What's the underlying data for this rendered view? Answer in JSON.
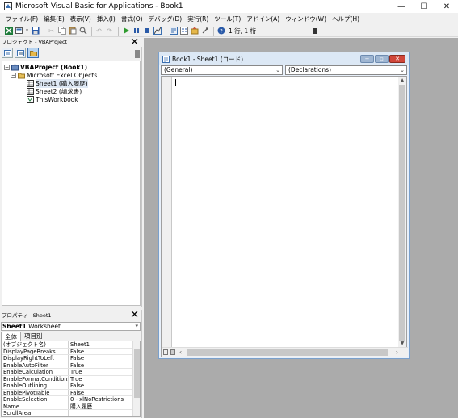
{
  "window": {
    "title": "Microsoft Visual Basic for Applications - Book1",
    "minimize": "—",
    "maximize": "☐",
    "close": "✕"
  },
  "menu": [
    "ファイル(F)",
    "編集(E)",
    "表示(V)",
    "挿入(I)",
    "書式(O)",
    "デバッグ(D)",
    "実行(R)",
    "ツール(T)",
    "アドイン(A)",
    "ウィンドウ(W)",
    "ヘルプ(H)"
  ],
  "toolbar": {
    "position": "1 行, 1 桁"
  },
  "project_pane": {
    "title": "プロジェクト - VBAProject",
    "tree": [
      {
        "label": "VBAProject (Book1)",
        "bold": true
      },
      {
        "label": "Microsoft Excel Objects"
      },
      {
        "label": "Sheet1 (購入履歴)"
      },
      {
        "label": "Sheet2 (請求書)"
      },
      {
        "label": "ThisWorkbook"
      }
    ]
  },
  "properties_pane": {
    "title": "プロパティ - Sheet1",
    "object_name": "Sheet1",
    "object_type": "Worksheet",
    "tabs": [
      "全体",
      "項目別"
    ],
    "rows": [
      {
        "name": "(オブジェクト名)",
        "value": "Sheet1"
      },
      {
        "name": "DisplayPageBreaks",
        "value": "False"
      },
      {
        "name": "DisplayRightToLeft",
        "value": "False"
      },
      {
        "name": "EnableAutoFilter",
        "value": "False"
      },
      {
        "name": "EnableCalculation",
        "value": "True"
      },
      {
        "name": "EnableFormatConditionsCa",
        "value": "True"
      },
      {
        "name": "EnableOutlining",
        "value": "False"
      },
      {
        "name": "EnablePivotTable",
        "value": "False"
      },
      {
        "name": "EnableSelection",
        "value": "0 - xlNoRestrictions"
      },
      {
        "name": "Name",
        "value": "購入履歴"
      },
      {
        "name": "ScrollArea",
        "value": ""
      }
    ]
  },
  "code_window": {
    "title": "Book1 - Sheet1 (コード)",
    "object_combo": "(General)",
    "proc_combo": "(Declarations)"
  }
}
